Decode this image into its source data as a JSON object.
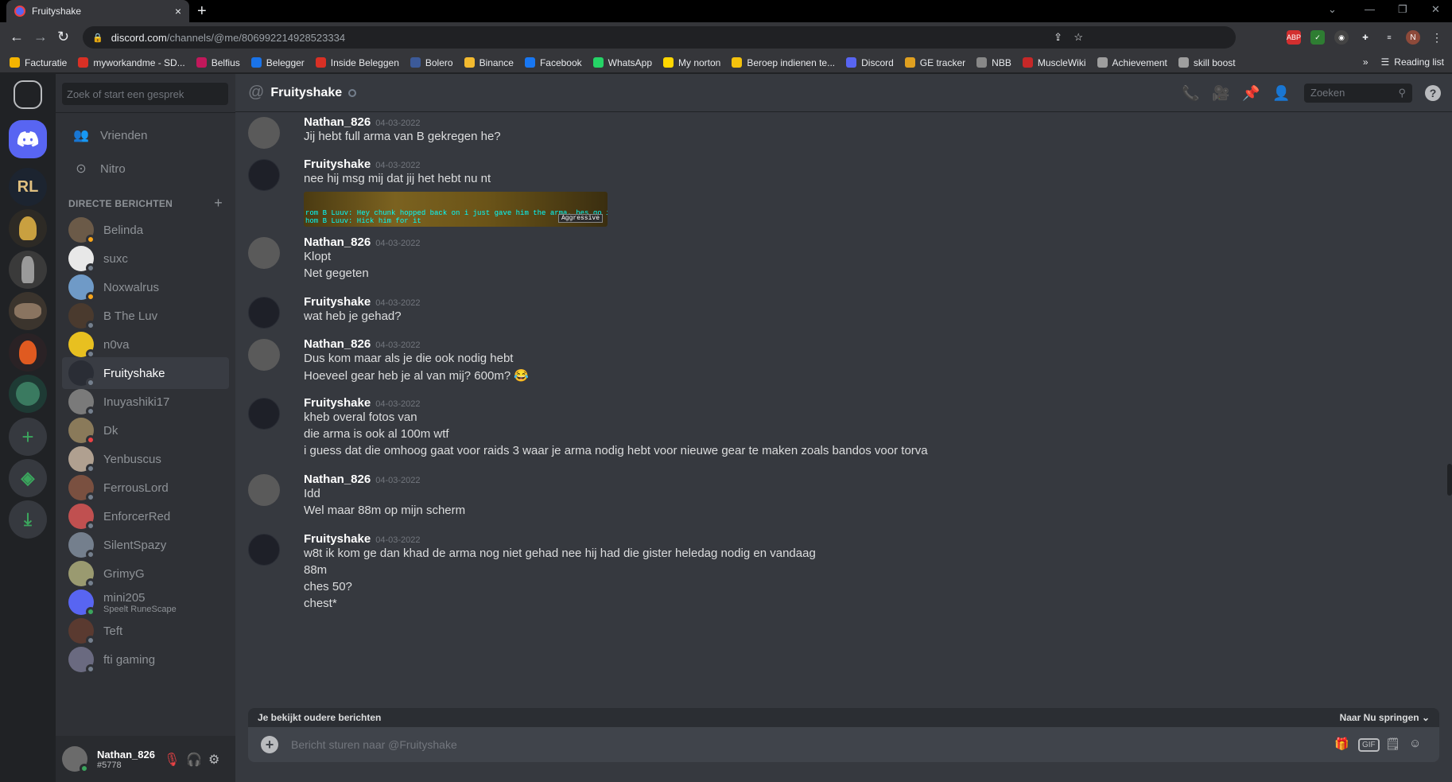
{
  "browser": {
    "tab_title": "Fruityshake",
    "url_host": "discord.com",
    "url_path": "/channels/@me/806992214928523334",
    "new_tab": "+",
    "close_tab": "×",
    "reading_list": "Reading list",
    "more_bookmarks": "»",
    "bookmarks": [
      {
        "label": "Facturatie",
        "color": "#f4b400"
      },
      {
        "label": "myworkandme - SD...",
        "color": "#d93025"
      },
      {
        "label": "Belfius",
        "color": "#c2185b"
      },
      {
        "label": "Belegger",
        "color": "#1a73e8"
      },
      {
        "label": "Inside Beleggen",
        "color": "#d93025"
      },
      {
        "label": "Bolero",
        "color": "#3c5a99"
      },
      {
        "label": "Binance",
        "color": "#f3ba2f"
      },
      {
        "label": "Facebook",
        "color": "#1877f2"
      },
      {
        "label": "WhatsApp",
        "color": "#25d366"
      },
      {
        "label": "My norton",
        "color": "#ffd700"
      },
      {
        "label": "Beroep indienen te...",
        "color": "#f4c20d"
      },
      {
        "label": "Discord",
        "color": "#5865f2"
      },
      {
        "label": "GE tracker",
        "color": "#e0a020"
      },
      {
        "label": "NBB",
        "color": "#888888"
      },
      {
        "label": "MuscleWiki",
        "color": "#c62828"
      },
      {
        "label": "Achievement",
        "color": "#9e9e9e"
      },
      {
        "label": "skill boost",
        "color": "#9e9e9e"
      }
    ],
    "ext_labels": {
      "abp": "ABP",
      "profile": "N"
    }
  },
  "sidebar": {
    "search_placeholder": "Zoek of start een gesprek",
    "nav": [
      {
        "label": "Vrienden",
        "icon": "friends-icon"
      },
      {
        "label": "Nitro",
        "icon": "nitro-icon"
      }
    ],
    "dm_header": "DIRECTE BERICHTEN",
    "dm_add": "+",
    "dms": [
      {
        "name": "Belinda",
        "sub": "",
        "color": "#6b5a48",
        "status": "#faa61a",
        "active": false
      },
      {
        "name": "suxc",
        "sub": "",
        "color": "#e8e8e8",
        "status": "#747f8d",
        "active": false
      },
      {
        "name": "Noxwalrus",
        "sub": "",
        "color": "#6f9ac7",
        "status": "#faa61a",
        "active": false
      },
      {
        "name": "B The Luv",
        "sub": "",
        "color": "#4a3a2e",
        "status": "#747f8d",
        "active": false
      },
      {
        "name": "n0va",
        "sub": "",
        "color": "#e8c020",
        "status": "#747f8d",
        "active": false
      },
      {
        "name": "Fruityshake",
        "sub": "",
        "color": "#2a2d35",
        "status": "#747f8d",
        "active": true
      },
      {
        "name": "Inuyashiki17",
        "sub": "",
        "color": "#7a7a7a",
        "status": "#747f8d",
        "active": false
      },
      {
        "name": "Dk",
        "sub": "",
        "color": "#8a7a5a",
        "status": "#ed4245",
        "active": false
      },
      {
        "name": "Yenbuscus",
        "sub": "",
        "color": "#b0a090",
        "status": "#747f8d",
        "active": false
      },
      {
        "name": "FerrousLord",
        "sub": "",
        "color": "#7a5040",
        "status": "#747f8d",
        "active": false
      },
      {
        "name": "EnforcerRed",
        "sub": "",
        "color": "#c05050",
        "status": "#747f8d",
        "active": false
      },
      {
        "name": "SilentSpazy",
        "sub": "",
        "color": "#747f8d",
        "status": "#747f8d",
        "active": false
      },
      {
        "name": "GrimyG",
        "sub": "",
        "color": "#9a9a70",
        "status": "#747f8d",
        "active": false
      },
      {
        "name": "mini205",
        "sub": "Speelt RuneScape",
        "color": "#5865f2",
        "status": "#3ba55d",
        "active": false
      },
      {
        "name": "Teft",
        "sub": "",
        "color": "#5a3a30",
        "status": "#747f8d",
        "active": false
      },
      {
        "name": "fti gaming",
        "sub": "",
        "color": "#6a6a80",
        "status": "#747f8d",
        "active": false
      }
    ]
  },
  "user": {
    "name": "Nathan_826",
    "tag": "#5778"
  },
  "guilds": {
    "home": "home",
    "servers": [
      "RL",
      "helmet",
      "knight",
      "wolf",
      "fire",
      "suxc"
    ]
  },
  "chat": {
    "recipient": "Fruityshake",
    "search_placeholder": "Zoeken",
    "messages": [
      {
        "author": "Nathan_826",
        "time": "04-03-2022",
        "who": "n",
        "lines": [
          "Jij hebt full arma van B gekregen he?"
        ]
      },
      {
        "author": "Fruityshake",
        "time": "04-03-2022",
        "who": "f",
        "lines": [
          "nee hij msg mij dat jij het hebt nu nt"
        ],
        "attachment": {
          "text1": "rom B Luuv: Hey chunk hopped back on i just gave him the arma, hes go it now if you wanna",
          "text2": "hom B Luuv: Hick him for it",
          "tag": "Aggressive"
        }
      },
      {
        "author": "Nathan_826",
        "time": "04-03-2022",
        "who": "n",
        "lines": [
          "Klopt",
          "Net gegeten"
        ]
      },
      {
        "author": "Fruityshake",
        "time": "04-03-2022",
        "who": "f",
        "lines": [
          "wat heb je gehad?"
        ]
      },
      {
        "author": "Nathan_826",
        "time": "04-03-2022",
        "who": "n",
        "lines": [
          "Dus kom maar als je die ook nodig hebt",
          "Hoeveel gear heb je al van mij? 600m? 😂"
        ]
      },
      {
        "author": "Fruityshake",
        "time": "04-03-2022",
        "who": "f",
        "lines": [
          "kheb overal fotos van",
          "die arma is ook al 100m wtf",
          "i guess dat die omhoog gaat voor raids 3 waar je arma nodig hebt voor nieuwe gear te maken zoals bandos voor torva"
        ]
      },
      {
        "author": "Nathan_826",
        "time": "04-03-2022",
        "who": "n",
        "lines": [
          "Idd",
          "Wel maar 88m op mijn scherm"
        ]
      },
      {
        "author": "Fruityshake",
        "time": "04-03-2022",
        "who": "f",
        "lines": [
          "w8t ik kom ge dan khad de arma nog niet gehad nee hij had die gister heledag nodig en vandaag",
          "88m",
          "ches 50?",
          "chest*"
        ]
      }
    ],
    "older_notice": "Je bekijkt oudere berichten",
    "jump_label": "Naar Nu springen",
    "composer_placeholder": "Bericht sturen naar @Fruityshake",
    "gif_label": "GIF"
  }
}
